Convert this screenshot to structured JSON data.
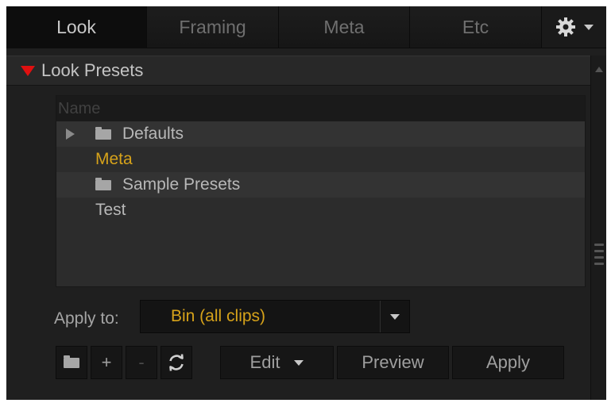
{
  "tabs": [
    {
      "label": "Look",
      "active": true
    },
    {
      "label": "Framing",
      "active": false
    },
    {
      "label": "Meta",
      "active": false
    },
    {
      "label": "Etc",
      "active": false
    }
  ],
  "section": {
    "title": "Look Presets",
    "expanded": true
  },
  "list": {
    "header": "Name",
    "items": [
      {
        "label": "Defaults",
        "type": "folder",
        "expandable": true
      },
      {
        "label": "Meta",
        "type": "preset",
        "selected": true
      },
      {
        "label": "Sample Presets",
        "type": "folder",
        "expandable": false
      },
      {
        "label": "Test",
        "type": "preset"
      }
    ]
  },
  "apply": {
    "label": "Apply to:",
    "value": "Bin (all clips)"
  },
  "buttons": {
    "plus": "+",
    "minus": "-",
    "edit": "Edit",
    "preview": "Preview",
    "apply": "Apply"
  },
  "colors": {
    "accent": "#d6a21a",
    "expand_arrow": "#e01010"
  },
  "icons": [
    "gear-icon",
    "folder-icon",
    "refresh-icon",
    "chevron-down-icon"
  ]
}
